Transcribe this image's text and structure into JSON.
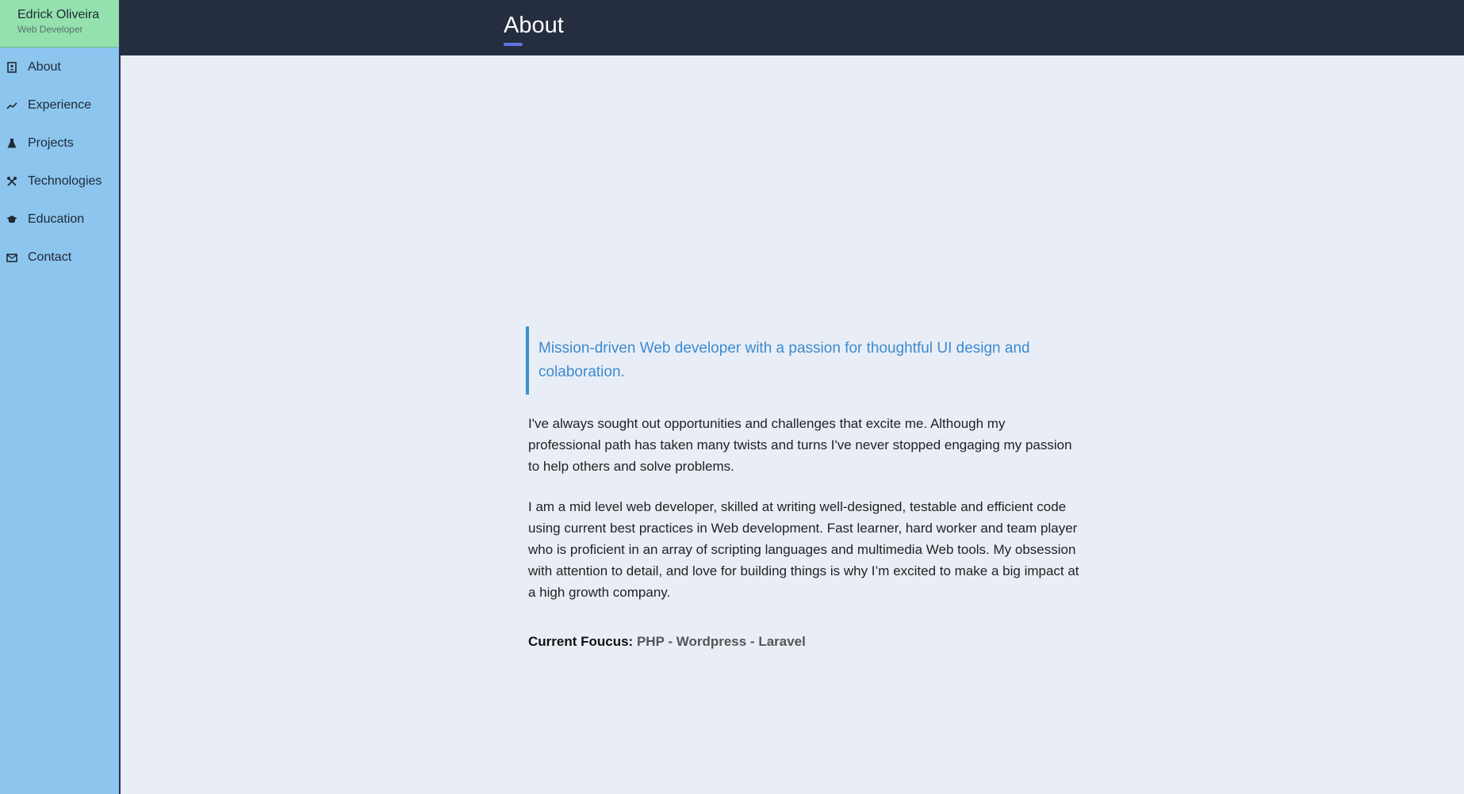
{
  "profile": {
    "name": "Edrick Oliveira",
    "role": "Web Developer"
  },
  "nav": [
    {
      "label": "About",
      "icon": "address-book-icon"
    },
    {
      "label": "Experience",
      "icon": "chart-line-icon"
    },
    {
      "label": "Projects",
      "icon": "flask-icon"
    },
    {
      "label": "Technologies",
      "icon": "tools-icon"
    },
    {
      "label": "Education",
      "icon": "graduation-cap-icon"
    },
    {
      "label": "Contact",
      "icon": "envelope-icon"
    }
  ],
  "header": {
    "title": "About"
  },
  "main": {
    "quote": "Mission-driven Web developer with a passion for thoughtful UI design and colaboration.",
    "paragraphs": [
      "I've always sought out opportunities and challenges that excite me. Although my professional path has taken many twists and turns I've never stopped engaging my passion to help others and solve problems.",
      "I am a mid level web developer, skilled at writing well-designed, testable and efficient code using current best practices in Web development. Fast learner, hard worker and team player who is proficient in an array of scripting languages and multimedia Web tools. My obsession with attention to detail, and love for building things is why I’m excited to make a big impact at a high growth company."
    ],
    "focus_label": "Current Foucus:",
    "focus_value": "PHP - Wordpress - Laravel"
  },
  "colors": {
    "sidebar": "#8cc5ee",
    "profile": "#94e1ae",
    "topbar": "#252d40",
    "accent": "#6673e6",
    "quote": "#3c8ad0",
    "background": "#e9eef6"
  }
}
